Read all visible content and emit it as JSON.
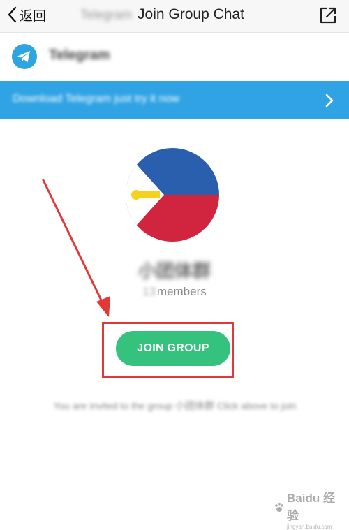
{
  "topbar": {
    "back_label": "返回",
    "title_prefix": "Telegram",
    "title": "Join Group Chat"
  },
  "app": {
    "name": "Telegram",
    "brand_color": "#2ca5e0"
  },
  "banner": {
    "text": "Download Telegram just try it now"
  },
  "group": {
    "name": "小团体群",
    "member_count": "13",
    "members_label": "members"
  },
  "join_button": {
    "label": "JOIN GROUP",
    "color": "#34c27d"
  },
  "note": {
    "text": "You are invited to the group 小团体群 Click above to join"
  },
  "watermark": {
    "brand": "Baidu 经验",
    "sub": "jingyan.baidu.com"
  },
  "annotation": {
    "color": "#e23838"
  }
}
